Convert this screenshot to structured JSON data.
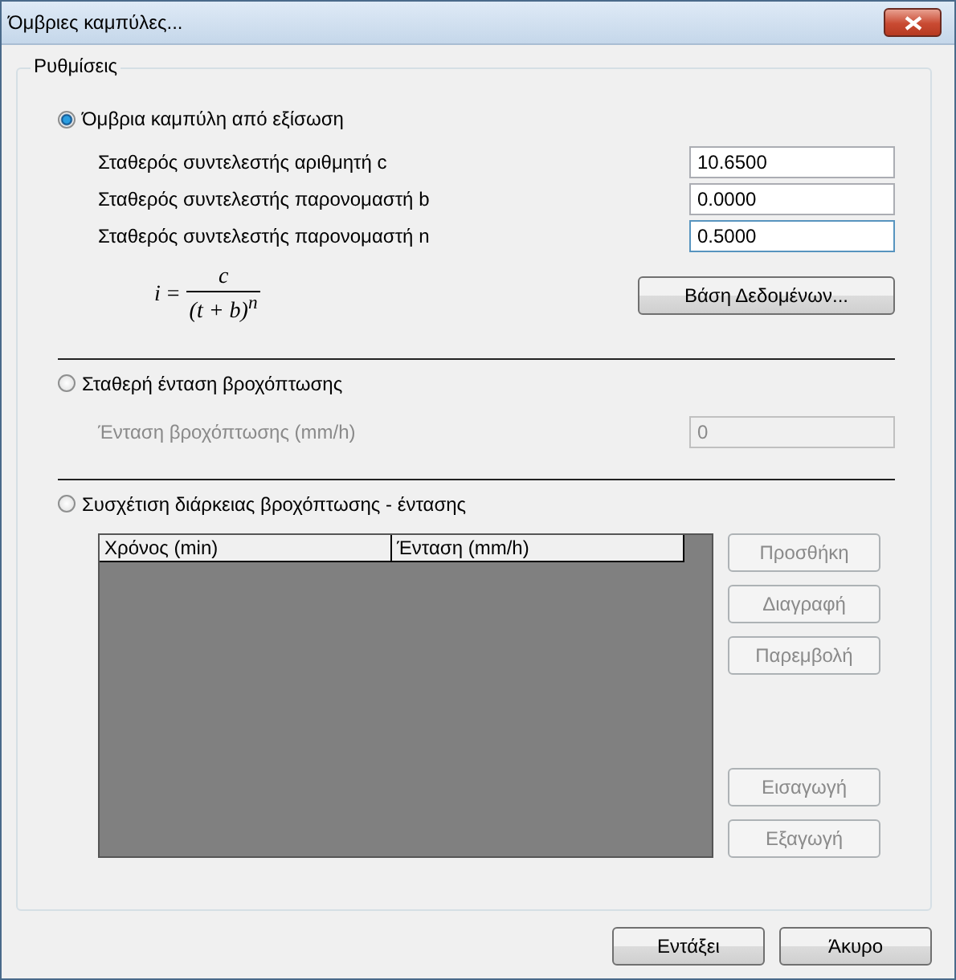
{
  "window": {
    "title": "Όμβριες καμπύλες..."
  },
  "group": {
    "title": "Ρυθμίσεις"
  },
  "options": [
    {
      "kind": "equation",
      "label": "Όμβρια καμπύλη από εξίσωση",
      "selected": true,
      "params": [
        {
          "label": "Σταθερός συντελεστής αριθμητή c",
          "value": "10.6500",
          "disabled": false,
          "focused": false
        },
        {
          "label": "Σταθερός συντελεστής παρονομαστή b",
          "value": "0.0000",
          "disabled": false,
          "focused": false
        },
        {
          "label": "Σταθερός συντελεστής παρονομαστή n",
          "value": "0.5000",
          "disabled": false,
          "focused": true
        }
      ],
      "formula": {
        "lhs": "i",
        "eq": "=",
        "numerator": "c",
        "denominator": "(t + b)$^{n}$"
      },
      "button": {
        "label": "Βάση Δεδομένων...",
        "disabled": false
      }
    },
    {
      "kind": "constant",
      "label": "Σταθερή ένταση βροχόπτωσης",
      "selected": false,
      "params": [
        {
          "label": "Ένταση βροχόπτωσης (mm/h)",
          "value": "0",
          "disabled": true,
          "focused": false
        }
      ]
    },
    {
      "kind": "table",
      "label": "Συσχέτιση διάρκειας βροχόπτωσης - έντασης",
      "selected": false,
      "columns": [
        "Χρόνος (min)",
        "Ένταση (mm/h)"
      ],
      "edit_buttons": [
        {
          "label": "Προσθήκη",
          "disabled": true
        },
        {
          "label": "Διαγραφή",
          "disabled": true
        },
        {
          "label": "Παρεμβολή",
          "disabled": true
        }
      ],
      "io_buttons": [
        {
          "label": "Εισαγωγή",
          "disabled": true
        },
        {
          "label": "Εξαγωγή",
          "disabled": true
        }
      ]
    }
  ],
  "buttons": [
    {
      "label": "Εντάξει"
    },
    {
      "label": "Άκυρο"
    }
  ]
}
